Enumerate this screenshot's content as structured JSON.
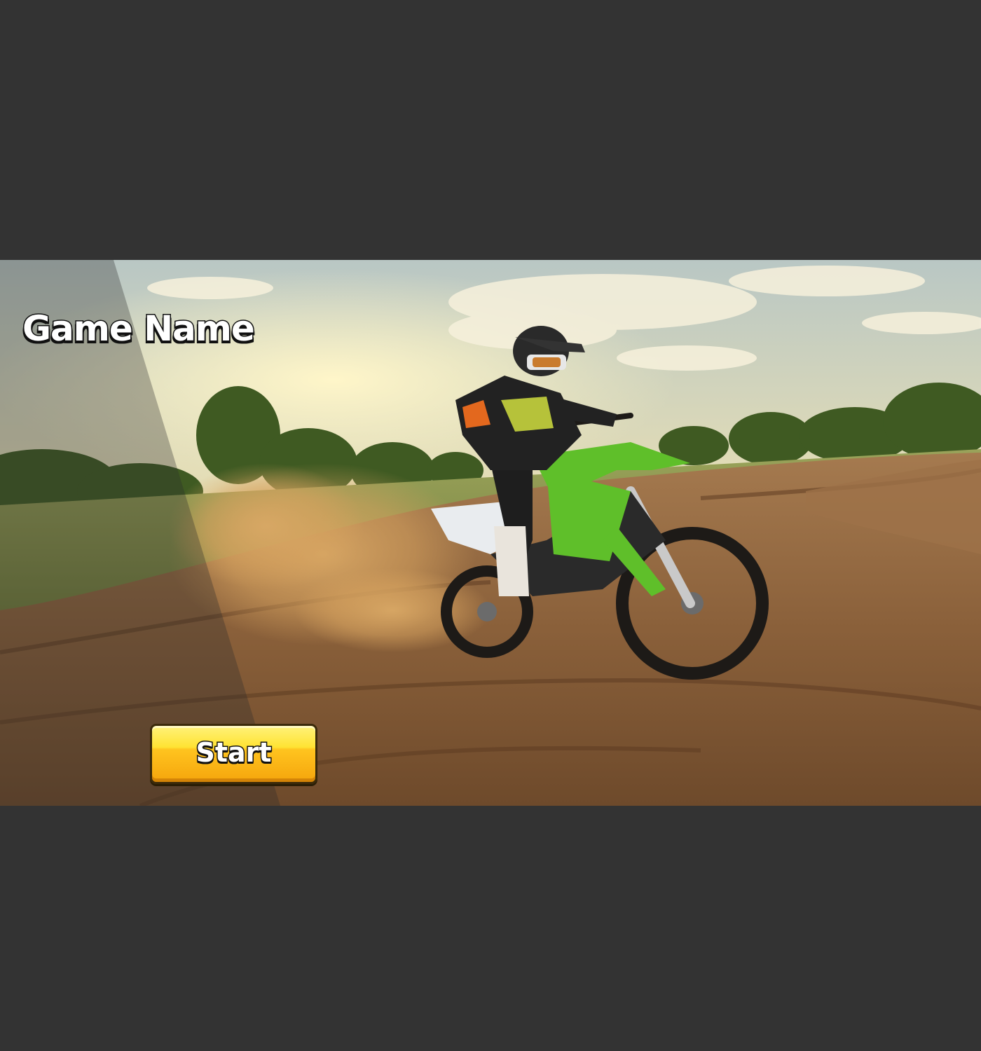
{
  "game": {
    "title": "Game Name"
  },
  "menu": {
    "start_label": "Start"
  },
  "colors": {
    "background": "#333333",
    "button_top": "#ffe333",
    "button_bottom": "#f5a50c",
    "button_border": "#3b2a0a",
    "text_fill": "#ffffff",
    "text_outline": "#111111",
    "bike_green": "#5fbf2a"
  }
}
